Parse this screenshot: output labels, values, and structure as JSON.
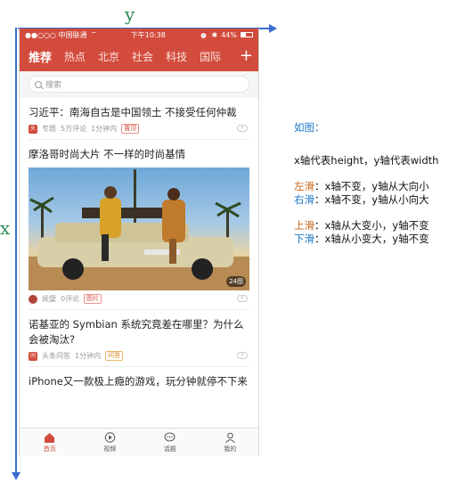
{
  "axes": {
    "y_label": "y",
    "x_label": "x"
  },
  "status_bar": {
    "carrier": "●●○○○ 中国联通 ",
    "time": "下午10:38",
    "battery": "44%"
  },
  "nav": {
    "tabs": [
      "推荐",
      "热点",
      "北京",
      "社会",
      "科技",
      "国际"
    ],
    "active_tab": "推荐",
    "plus": "+"
  },
  "search": {
    "placeholder": "搜索"
  },
  "articles": [
    {
      "title": "习近平：南海自古是中国领土 不接受任何仲裁",
      "source_badge": "专题",
      "source": "专题",
      "comments": "5万评论",
      "time": "1分钟内",
      "tag": "置顶"
    },
    {
      "title": "摩洛哥时尚大片 不一样的时尚基情",
      "source": "侯璧",
      "comments": "0评论",
      "tag": "图片",
      "duration": "24图"
    },
    {
      "title": "诺基亚的 Symbian 系统究竟差在哪里？为什么会被淘汰?",
      "source_badge": "问答",
      "source": "头条问答",
      "time": "1分钟内",
      "tag": "问答"
    },
    {
      "title": "iPhone又一款极上瘾的游戏，玩分钟就停不下来"
    }
  ],
  "tabbar": [
    {
      "label": "首页",
      "icon": "home-icon",
      "active": true
    },
    {
      "label": "视频",
      "icon": "play-icon",
      "active": false
    },
    {
      "label": "话题",
      "icon": "chat-icon",
      "active": false
    },
    {
      "label": "我的",
      "icon": "user-icon",
      "active": false
    }
  ],
  "notes": {
    "heading": "如图：",
    "line1": "x轴代表height，y轴代表width",
    "left_label": "左滑",
    "left_text": "：x轴不变，y轴从大向小",
    "right_label": "右滑",
    "right_text": "：x轴不变，y轴从小向大",
    "up_label": "上滑",
    "up_text": "：x轴从大变小，y轴不变",
    "down_label": "下滑",
    "down_text": "：x轴从小变大，y轴不变"
  },
  "colors": {
    "brand_red": "#d24b3c",
    "axis_blue": "#3a6fd1",
    "axis_label_green": "#2c8a55",
    "note_blue": "#1f78c8",
    "note_orange": "#c8691d"
  }
}
